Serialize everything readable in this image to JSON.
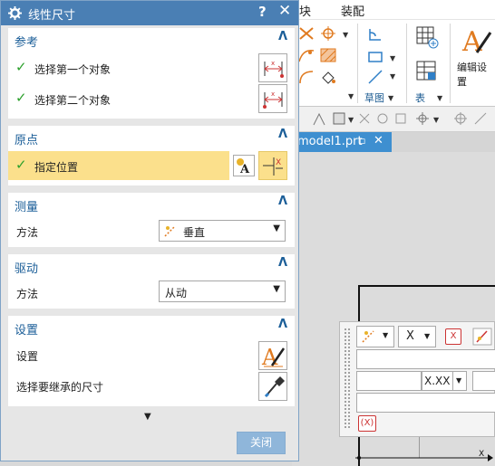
{
  "menubar": {
    "items": [
      "块",
      "装配"
    ]
  },
  "ribbon": {
    "group_sketch": "草图",
    "group_table": "表",
    "edit_setting_label": "编辑设置"
  },
  "file_tab": {
    "label": "model1.prt"
  },
  "dialog": {
    "title": "线性尺寸",
    "help": "?",
    "sections": {
      "reference": {
        "title": "参考",
        "rows": [
          "选择第一个对象",
          "选择第二个对象"
        ]
      },
      "origin": {
        "title": "原点",
        "row": "指定位置"
      },
      "measure": {
        "title": "测量",
        "method_label": "方法",
        "method_value": "垂直"
      },
      "drive": {
        "title": "驱动",
        "method_label": "方法",
        "method_value": "从动"
      },
      "settings": {
        "title": "设置",
        "settings_label": "设置",
        "inherit_label": "选择要继承的尺寸"
      }
    },
    "close_button": "关闭"
  },
  "edit_widget": {
    "type_value": "X",
    "precision_value": "X.XX",
    "xbox_label": "(X)"
  },
  "colors": {
    "titlebar": "#4a7fb4",
    "section_title": "#1b5e98",
    "highlight": "#fbe08c",
    "check": "#2ca02c",
    "tab": "#3e8fd0"
  }
}
